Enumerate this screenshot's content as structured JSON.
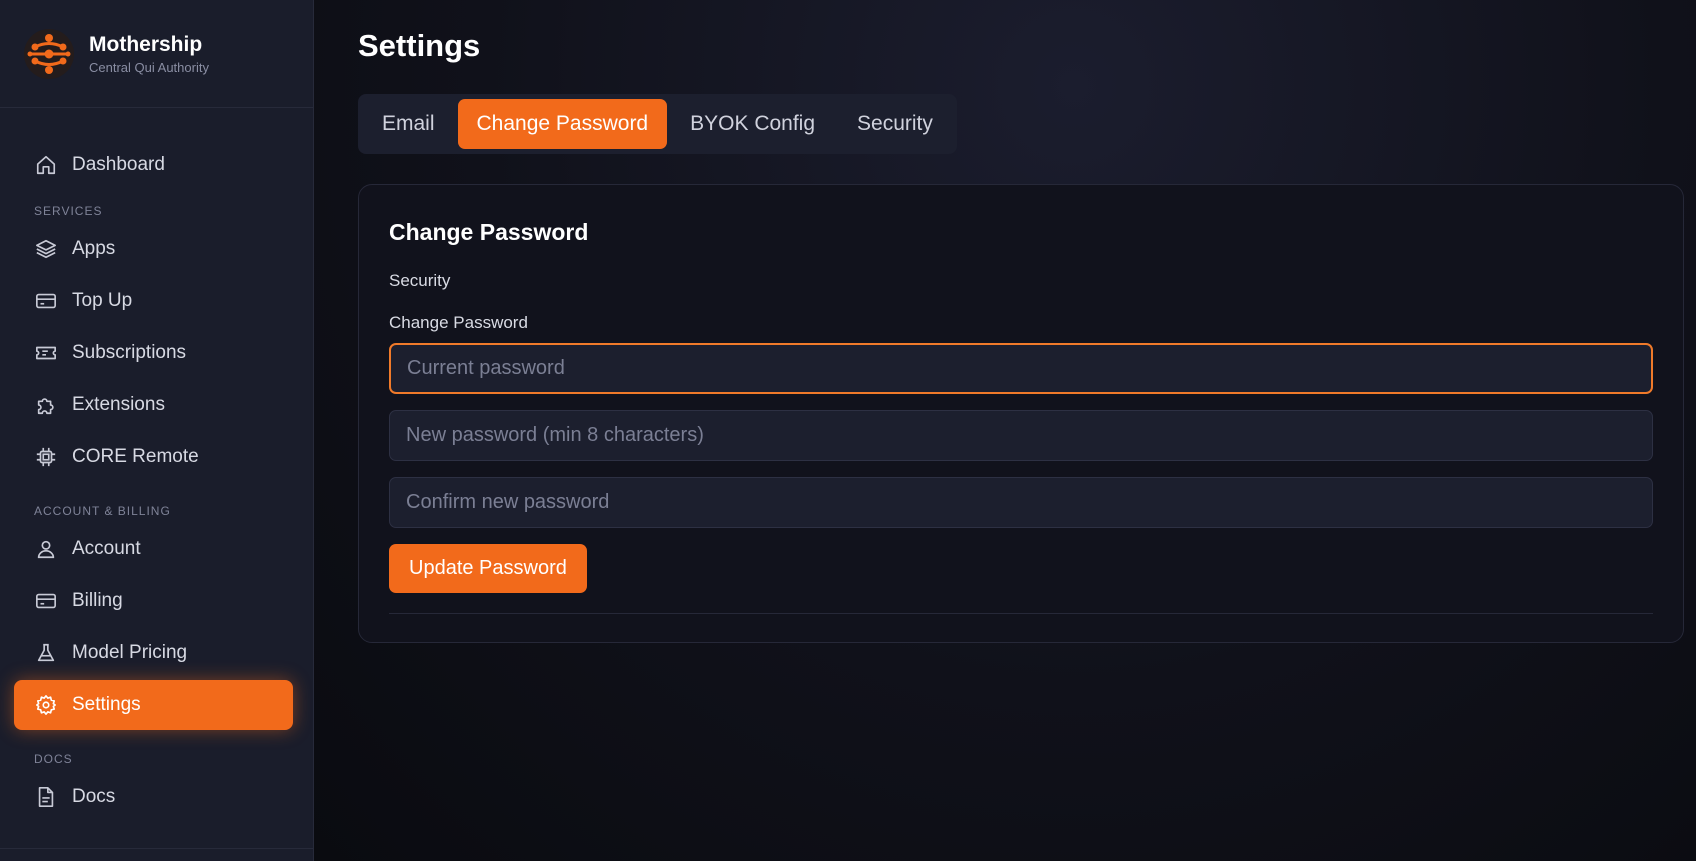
{
  "brand": {
    "name": "Mothership",
    "subtitle": "Central Qui Authority",
    "accent_color": "#f26a1b"
  },
  "sidebar": {
    "items_top": [
      {
        "label": "Dashboard",
        "icon": "home-icon"
      }
    ],
    "sections": [
      {
        "title": "SERVICES",
        "items": [
          {
            "label": "Apps",
            "icon": "layers-icon"
          },
          {
            "label": "Top Up",
            "icon": "credit-card-icon"
          },
          {
            "label": "Subscriptions",
            "icon": "ticket-icon"
          },
          {
            "label": "Extensions",
            "icon": "puzzle-icon"
          },
          {
            "label": "CORE Remote",
            "icon": "chip-icon"
          }
        ]
      },
      {
        "title": "ACCOUNT & BILLING",
        "items": [
          {
            "label": "Account",
            "icon": "user-icon"
          },
          {
            "label": "Billing",
            "icon": "credit-card-icon"
          },
          {
            "label": "Model Pricing",
            "icon": "flask-icon"
          },
          {
            "label": "Settings",
            "icon": "gear-icon",
            "active": true
          }
        ]
      },
      {
        "title": "DOCS",
        "items": [
          {
            "label": "Docs",
            "icon": "document-icon"
          }
        ]
      }
    ]
  },
  "main": {
    "page_title": "Settings",
    "tabs": [
      {
        "label": "Email"
      },
      {
        "label": "Change Password",
        "active": true
      },
      {
        "label": "BYOK Config"
      },
      {
        "label": "Security"
      }
    ],
    "card": {
      "title": "Change Password",
      "section_label": "Security",
      "sub_label": "Change Password",
      "current_password": {
        "placeholder": "Current password",
        "value": ""
      },
      "new_password": {
        "placeholder": "New password (min 8 characters)",
        "value": ""
      },
      "confirm_password": {
        "placeholder": "Confirm new password",
        "value": ""
      },
      "submit_label": "Update Password"
    }
  }
}
